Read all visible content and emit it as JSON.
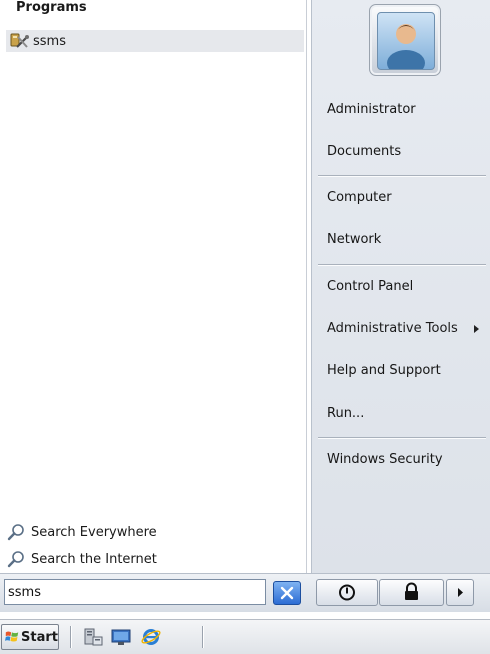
{
  "left_pane": {
    "programs_header": "Programs",
    "program_items": [
      {
        "label": "ssms",
        "icon": "ssms-tools-icon"
      }
    ],
    "search_links": [
      {
        "label": "Search Everywhere",
        "icon": "magnifier-icon"
      },
      {
        "label": "Search the Internet",
        "icon": "magnifier-icon"
      }
    ]
  },
  "right_pane": {
    "items": [
      {
        "label": "Administrator"
      },
      {
        "label": "Documents"
      },
      {
        "label": "Computer"
      },
      {
        "label": "Network"
      },
      {
        "label": "Control Panel"
      },
      {
        "label": "Administrative Tools",
        "has_submenu": true
      },
      {
        "label": "Help and Support"
      },
      {
        "label": "Run..."
      },
      {
        "label": "Windows Security"
      }
    ]
  },
  "search_box": {
    "value": "ssms"
  },
  "power_buttons": [
    "shutdown-icon",
    "lock-icon",
    "arrow-right-icon"
  ],
  "taskbar": {
    "start_label": "Start",
    "quick_launch": [
      "server-manager-icon",
      "show-desktop-icon",
      "internet-explorer-icon"
    ]
  },
  "colors": {
    "accent": "#2c6cd4",
    "highlight": "#e6e8ec",
    "right_pane_bg": "#e1e6ec"
  }
}
